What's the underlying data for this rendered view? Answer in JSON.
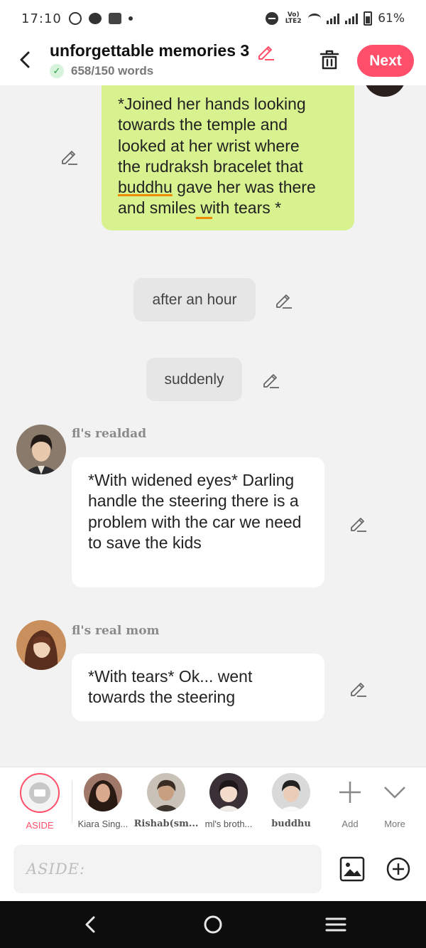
{
  "status_bar": {
    "time": "17:10",
    "network": "Vo) LTE2",
    "battery": "61%"
  },
  "header": {
    "title": "unforgettable memories 3",
    "word_count": "658/150 words",
    "next_label": "Next",
    "accent_color": "#ff4f6b"
  },
  "chat": {
    "green_message": {
      "lines": [
        "*Joined her hands looking",
        "towards the temple and",
        "looked at her wrist where",
        "the rudraksh bracelet that"
      ],
      "line5_underlined": "buddhu",
      "line5_rest": " gave her was there",
      "line6_before": "and smiles",
      "line6_underlined": " w",
      "line6_after": "ith tears *"
    },
    "narrations": [
      "after an hour",
      "suddenly"
    ],
    "messages": [
      {
        "character": "fl's realdad",
        "text": "*With widened eyes* Darling handle the steering there is a problem with the car we need to save the kids"
      },
      {
        "character": "fl's real mom",
        "text": "*With tears* Ok... went towards the steering"
      }
    ]
  },
  "characters": {
    "aside": "ASIDE",
    "items": [
      "Kiara Sing...",
      "Rishab(sm...",
      "ml's broth...",
      "buddhu"
    ],
    "add": "Add",
    "more": "More"
  },
  "input": {
    "placeholder": "ASIDE:"
  }
}
